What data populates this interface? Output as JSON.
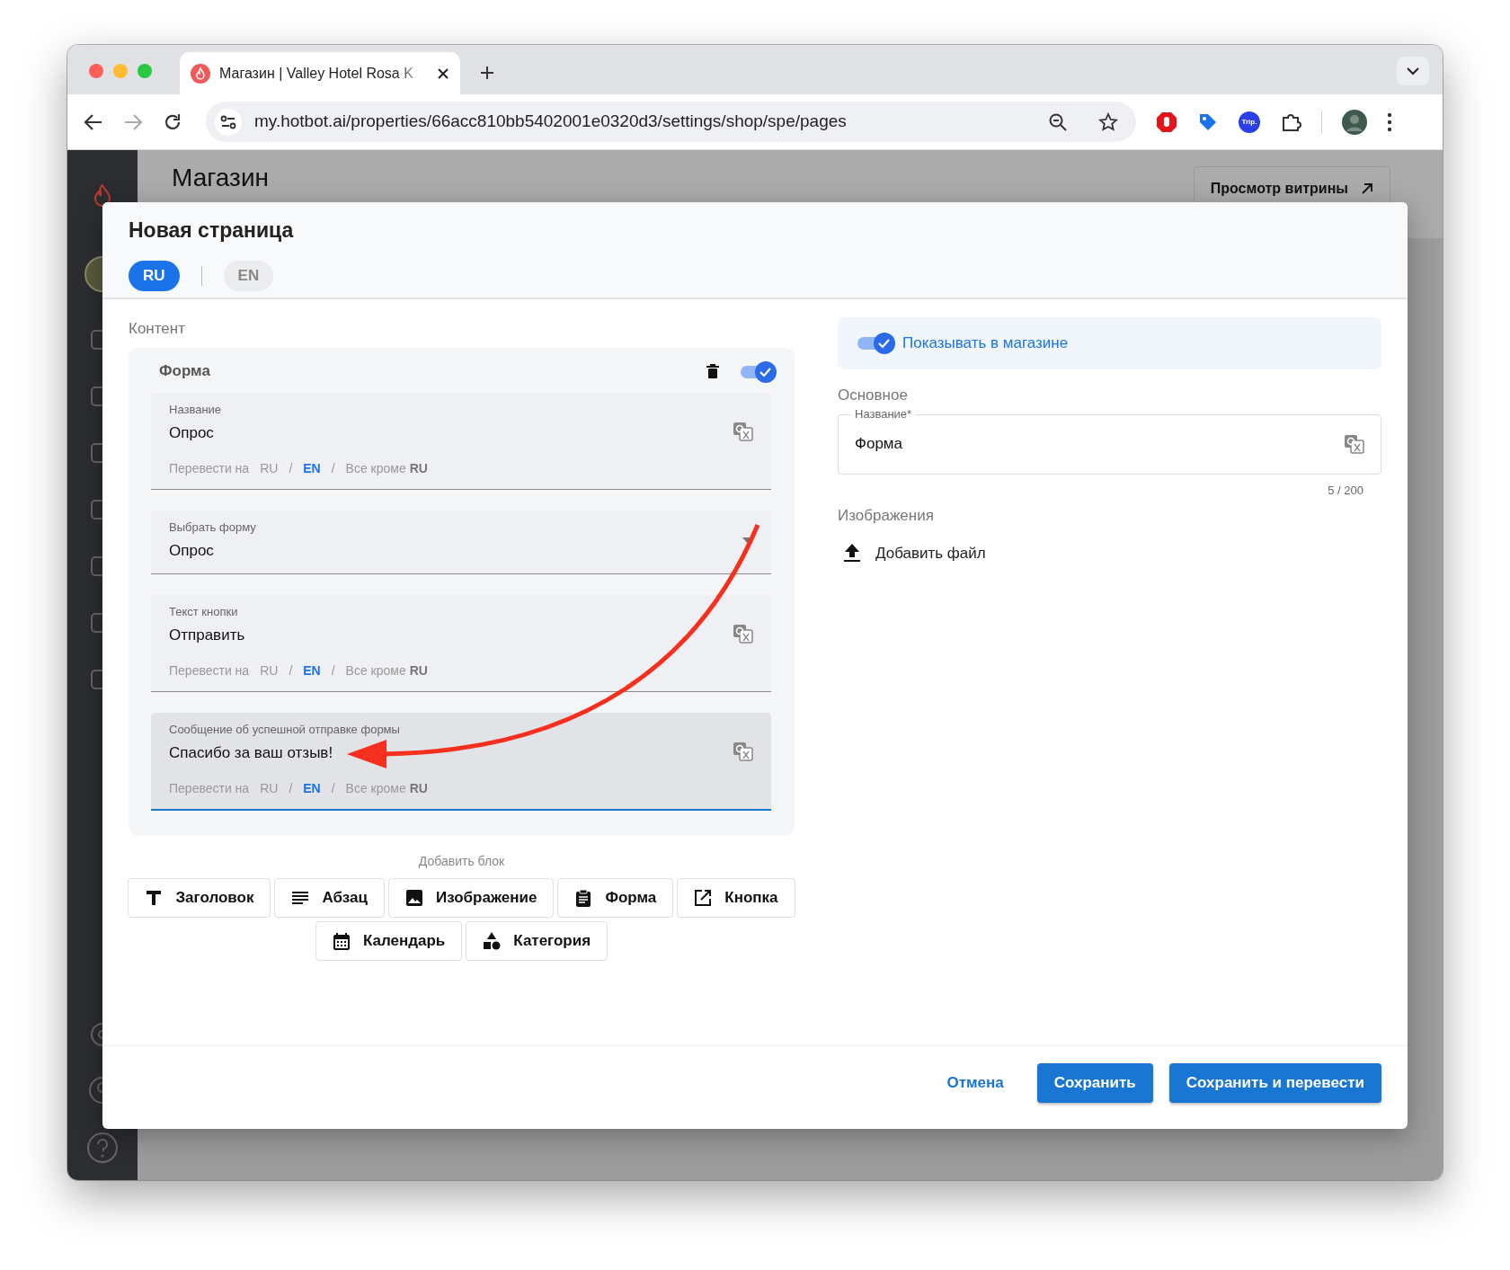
{
  "browser": {
    "tab_title": "Магазин | Valley Hotel Rosa K",
    "url": "my.hotbot.ai/properties/66acc810bb5402001e0320d3/settings/shop/spe/pages",
    "extension_badge": "Trip."
  },
  "app": {
    "page_title": "Магазин",
    "header_button": "Просмотр витрины"
  },
  "dialog": {
    "title": "Новая страница",
    "languages": [
      {
        "label": "RU",
        "selected": true
      },
      {
        "label": "EN",
        "selected": false
      }
    ],
    "content_label": "Контент",
    "block": {
      "title": "Форма",
      "enabled": true,
      "fields": [
        {
          "kind": "translatable",
          "label": "Название",
          "value": "Опрос",
          "focused": false,
          "translate": {
            "prefix": "Перевести на",
            "items": [
              {
                "kind": "lang",
                "label": "RU",
                "selected": false
              },
              {
                "kind": "sep",
                "label": "/"
              },
              {
                "kind": "lang",
                "label": "EN",
                "selected": true
              },
              {
                "kind": "sep",
                "label": "/"
              },
              {
                "kind": "all",
                "label": "Все кроме **RU**"
              }
            ]
          }
        },
        {
          "kind": "select",
          "label": "Выбрать форму",
          "value": "Опрос",
          "focused": false
        },
        {
          "kind": "translatable",
          "label": "Текст кнопки",
          "value": "Отправить",
          "focused": false,
          "translate": {
            "prefix": "Перевести на",
            "items": [
              {
                "kind": "lang",
                "label": "RU",
                "selected": false
              },
              {
                "kind": "sep",
                "label": "/"
              },
              {
                "kind": "lang",
                "label": "EN",
                "selected": true
              },
              {
                "kind": "sep",
                "label": "/"
              },
              {
                "kind": "all",
                "label": "Все кроме **RU**"
              }
            ]
          }
        },
        {
          "kind": "translatable",
          "label": "Сообщение об успешной отправке формы",
          "value": "Спасибо за ваш отзыв!",
          "focused": true,
          "translate": {
            "prefix": "Перевести на",
            "items": [
              {
                "kind": "lang",
                "label": "RU",
                "selected": false
              },
              {
                "kind": "sep",
                "label": "/"
              },
              {
                "kind": "lang",
                "label": "EN",
                "selected": true
              },
              {
                "kind": "sep",
                "label": "/"
              },
              {
                "kind": "all",
                "label": "Все кроме **RU**"
              }
            ]
          }
        }
      ]
    },
    "add_block": {
      "label": "Добавить блок",
      "buttons": [
        {
          "label": "Заголовок"
        },
        {
          "label": "Абзац"
        },
        {
          "label": "Изображение"
        },
        {
          "label": "Форма"
        },
        {
          "label": "Кнопка"
        },
        {
          "label": "Календарь"
        },
        {
          "label": "Категория"
        }
      ]
    },
    "side": {
      "show_in_shop": {
        "label": "Показывать в магазине",
        "on": true
      },
      "section_label": "Основное",
      "name_field": {
        "label": "Название*",
        "value": "Форма",
        "counter": "5 / 200"
      },
      "images_label": "Изображения",
      "add_file": "Добавить файл"
    },
    "footer": [
      {
        "kind": "link",
        "label": "Отмена"
      },
      {
        "kind": "primary",
        "label": "Сохранить"
      },
      {
        "kind": "primary",
        "label": "Сохранить и перевести"
      }
    ]
  }
}
